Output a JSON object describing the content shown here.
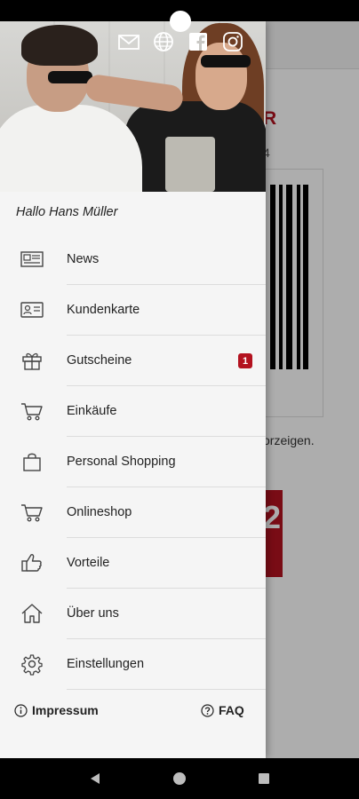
{
  "hero": {
    "icons": [
      "mail-icon",
      "globe-icon",
      "facebook-icon",
      "instagram-icon"
    ]
  },
  "greeting": "Hallo Hans Müller",
  "menu": [
    {
      "label": "News",
      "icon": "newspaper-icon"
    },
    {
      "label": "Kundenkarte",
      "icon": "id-card-icon"
    },
    {
      "label": "Gutscheine",
      "icon": "gift-icon",
      "badge": "1"
    },
    {
      "label": "Einkäufe",
      "icon": "cart-icon"
    },
    {
      "label": "Personal Shopping",
      "icon": "shopping-bag-icon"
    },
    {
      "label": "Onlineshop",
      "icon": "cart-icon"
    },
    {
      "label": "Vorteile",
      "icon": "thumbs-up-icon"
    },
    {
      "label": "Über uns",
      "icon": "home-icon"
    },
    {
      "label": "Einstellungen",
      "icon": "gear-icon"
    }
  ],
  "footer": {
    "impressum": "Impressum",
    "faq": "FAQ"
  },
  "background": {
    "title_fragment": "R",
    "sub_fragment": "4",
    "text_fragment": "orzeigen.",
    "red_fragment": "2"
  },
  "colors": {
    "accent": "#b3121f",
    "drawer_bg": "#f5f5f5"
  }
}
